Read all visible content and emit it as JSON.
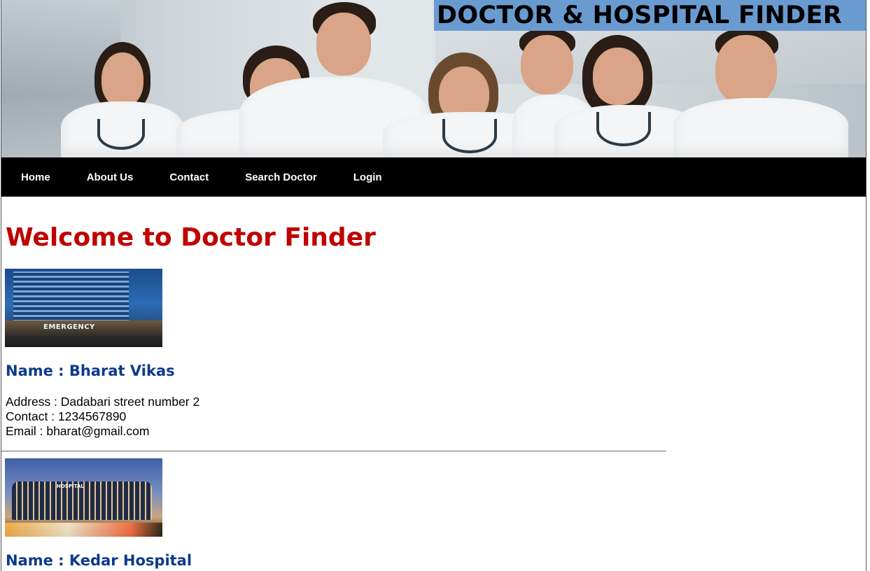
{
  "header": {
    "title": "DOCTOR & HOSPITAL FINDER",
    "banner_image": "doctors-team-photo"
  },
  "nav": {
    "items": [
      {
        "label": "Home"
      },
      {
        "label": "About Us"
      },
      {
        "label": "Contact"
      },
      {
        "label": "Search Doctor"
      },
      {
        "label": "Login"
      }
    ]
  },
  "main": {
    "heading": "Welcome to Doctor Finder",
    "hospitals": [
      {
        "name": "Name : Bharat Vikas",
        "address": "Address : Dadabari street number 2",
        "contact": "Contact : 1234567890",
        "email": "Email : bharat@gmail.com",
        "image_label": "EMERGENCY"
      },
      {
        "name": "Name : Kedar Hospital",
        "image_label": "HOSPITAL"
      }
    ]
  },
  "colors": {
    "title_bg": "#6a9bd0",
    "nav_bg": "#000000",
    "heading": "#c00000",
    "hospital_name": "#0d3a8c"
  }
}
